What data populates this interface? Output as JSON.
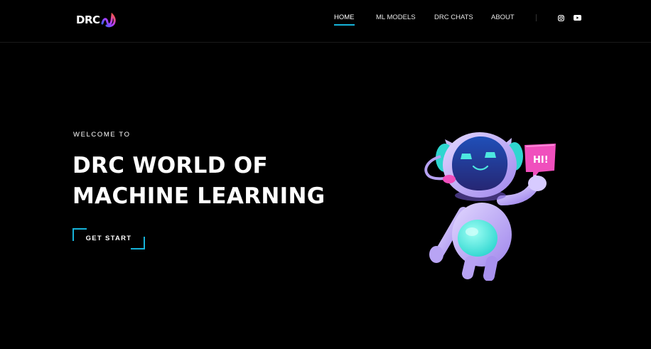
{
  "brand": {
    "name": "DRC",
    "logo_icon": "drc-swirl-logo-icon"
  },
  "nav": {
    "items": [
      {
        "label": "HOME",
        "active": true
      },
      {
        "label": "ML MODELS",
        "active": false
      },
      {
        "label": "DRC CHATS",
        "active": false
      },
      {
        "label": "ABOUT",
        "active": false
      }
    ]
  },
  "social": [
    {
      "icon": "instagram-icon"
    },
    {
      "icon": "youtube-icon"
    }
  ],
  "hero": {
    "eyebrow": "WELCOME TO",
    "title_line1": "DRC WORLD OF",
    "title_line2": "MACHINE LEARNING",
    "cta_label": "GET START",
    "illustration": {
      "bubble_text": "HI!"
    }
  },
  "colors": {
    "background": "#000000",
    "accent": "#16b3d9",
    "bubble": "#f04fbd",
    "robot_body": "#c9b8f5",
    "robot_screen": "#2a2f8a"
  }
}
